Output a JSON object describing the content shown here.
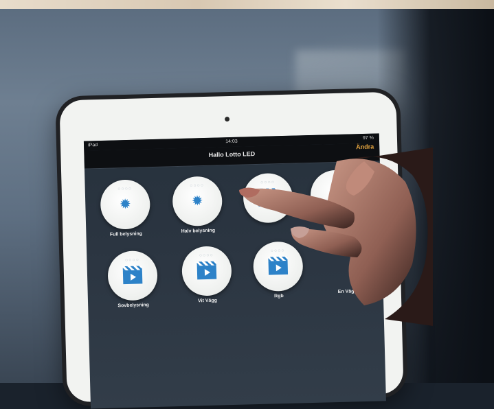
{
  "status": {
    "left": "iPad",
    "time": "14:03",
    "battery": "97 %"
  },
  "header": {
    "title": "Hallo Lotto LED",
    "edit_label": "Ändra"
  },
  "scenes": [
    {
      "label": "Full belysning",
      "icon": "sun-icon"
    },
    {
      "label": "Halv belysning",
      "icon": "sun-icon"
    },
    {
      "label": "",
      "icon": "play-clapper-icon"
    },
    {
      "label": "",
      "icon": "circle"
    },
    {
      "label": "Sovbelysning",
      "icon": "play-clapper-icon"
    },
    {
      "label": "Vit Vägg",
      "icon": "play-clapper-icon"
    },
    {
      "label": "Rgb",
      "icon": "play-clapper-icon"
    },
    {
      "label": "En Vägg",
      "icon": "circle"
    }
  ],
  "colors": {
    "accent": "#e7a640",
    "icon_blue": "#2d82c8"
  }
}
